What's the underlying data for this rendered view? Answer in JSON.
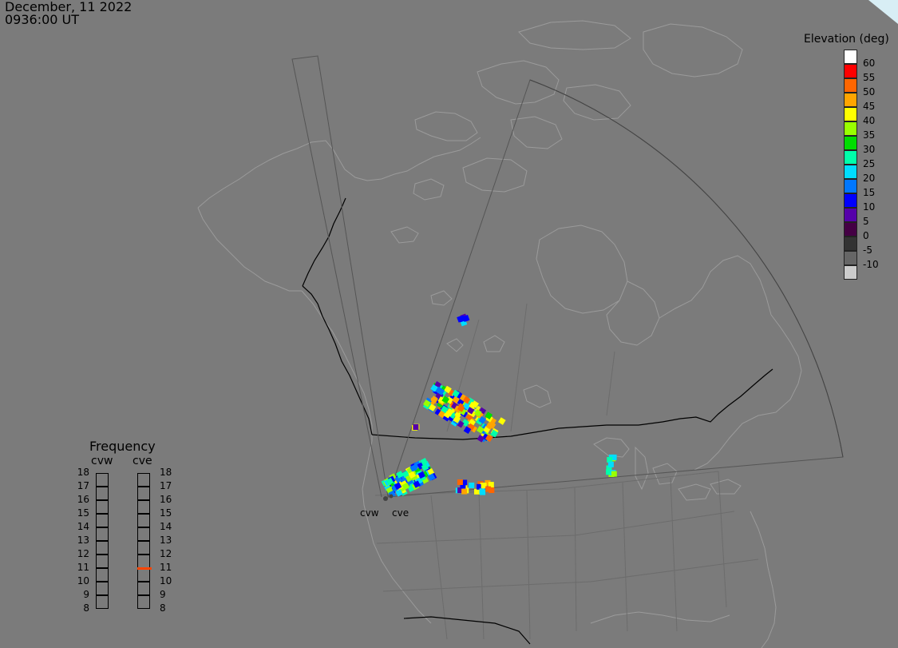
{
  "header": {
    "date": "December, 11 2022",
    "time": "0936:00 UT"
  },
  "elevation_scale": {
    "title": "Elevation (deg)",
    "levels": [
      {
        "label": "60",
        "color": "#ffffff"
      },
      {
        "label": "55",
        "color": "#ff0000"
      },
      {
        "label": "50",
        "color": "#ff6600"
      },
      {
        "label": "45",
        "color": "#ffa500"
      },
      {
        "label": "40",
        "color": "#ffff00"
      },
      {
        "label": "35",
        "color": "#99ff00"
      },
      {
        "label": "30",
        "color": "#00dd00"
      },
      {
        "label": "25",
        "color": "#00ffaa"
      },
      {
        "label": "20",
        "color": "#00ddff"
      },
      {
        "label": "15",
        "color": "#0077ff"
      },
      {
        "label": "10",
        "color": "#0000ff"
      },
      {
        "label": "5",
        "color": "#5500aa"
      },
      {
        "label": "0",
        "color": "#440044"
      },
      {
        "label": "-5",
        "color": "#333333"
      },
      {
        "label": "-10",
        "color": "#666666"
      },
      {
        "label": "",
        "color": "#cccccc"
      }
    ]
  },
  "frequency": {
    "title": "Frequency",
    "radars": [
      "cvw",
      "cve"
    ],
    "levels": [
      "18",
      "17",
      "16",
      "15",
      "14",
      "13",
      "12",
      "11",
      "10",
      "9",
      "8"
    ],
    "cve_active": 11,
    "active_color": "#ff4400"
  },
  "stations": [
    {
      "label": "cvw"
    },
    {
      "label": "cve"
    }
  ],
  "colors": {
    "background": "#7b7b7b",
    "coast": "#9a9a9a",
    "border": "#000000",
    "fov": "#555555"
  }
}
